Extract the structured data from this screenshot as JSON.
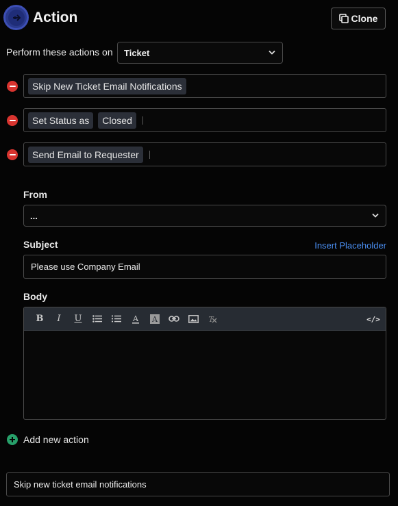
{
  "header": {
    "title": "Action",
    "clone_label": "Clone"
  },
  "perform": {
    "label": "Perform these actions on",
    "selected": "Ticket"
  },
  "actions": [
    {
      "tags": [
        "Skip New Ticket Email Notifications"
      ]
    },
    {
      "tags": [
        "Set Status as",
        "Closed"
      ]
    },
    {
      "tags": [
        "Send Email to Requester"
      ]
    }
  ],
  "email": {
    "from_label": "From",
    "from_value": "...",
    "subject_label": "Subject",
    "insert_placeholder": "Insert Placeholder",
    "subject_value": "Please use Company Email",
    "body_label": "Body",
    "body_value": ""
  },
  "toolbar": {
    "bold": "B",
    "italic": "I",
    "underline": "U",
    "code": "</>"
  },
  "add_action_label": "Add new action",
  "description_value": "Skip new ticket email notifications",
  "colors": {
    "remove": "#d8342f",
    "add": "#27a06a",
    "link": "#4a8ef2",
    "logo": "#2a3a8c"
  }
}
